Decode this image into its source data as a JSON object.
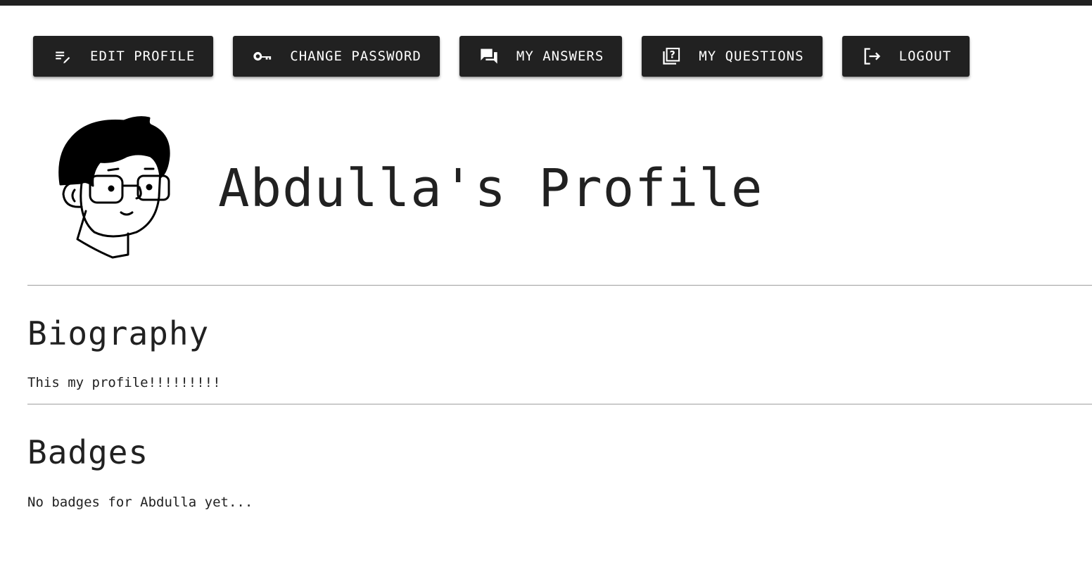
{
  "actions": {
    "edit_profile": {
      "label": "EDIT PROFILE",
      "icon": "edit-note-icon"
    },
    "change_password": {
      "label": "CHANGE PASSWORD",
      "icon": "key-icon"
    },
    "my_answers": {
      "label": "MY ANSWERS",
      "icon": "forum-icon"
    },
    "my_questions": {
      "label": "MY QUESTIONS",
      "icon": "quiz-icon"
    },
    "logout": {
      "label": "LOGOUT",
      "icon": "logout-icon"
    }
  },
  "profile": {
    "title": "Abdulla's Profile",
    "avatar": "avatar-illustration"
  },
  "biography": {
    "heading": "Biography",
    "text": "This my profile!!!!!!!!!"
  },
  "badges": {
    "heading": "Badges",
    "text": "No badges for Abdulla yet..."
  },
  "colors": {
    "primary": "#212121",
    "background": "#ffffff",
    "divider": "#9e9e9e"
  }
}
